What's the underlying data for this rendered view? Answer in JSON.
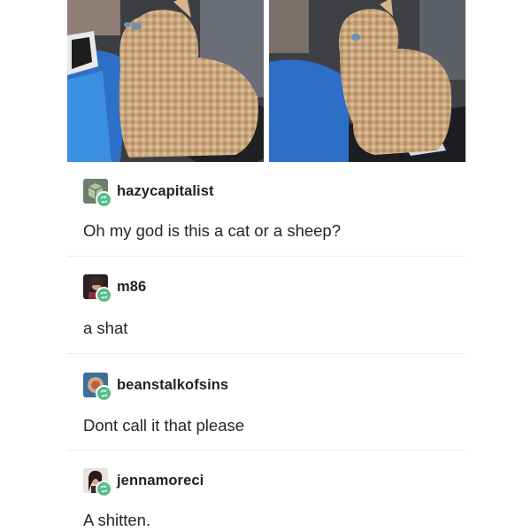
{
  "post": {
    "photos": [
      {
        "alt": "curly kitten photo 1",
        "accent": "#c8a37c"
      },
      {
        "alt": "curly kitten photo 2",
        "accent": "#c4a07a"
      }
    ],
    "entries": [
      {
        "username": "hazycapitalist",
        "text": "Oh my god is this a cat or a sheep?",
        "avatar_icon": "cube-avatar-icon"
      },
      {
        "username": "m86",
        "text": "a shat",
        "avatar_icon": "portrait-avatar-icon"
      },
      {
        "username": "beanstalkofsins",
        "text": "Dont call it that please",
        "avatar_icon": "circle-avatar-icon"
      },
      {
        "username": "jennamoreci",
        "text": "A shitten.",
        "avatar_icon": "portrait-avatar-icon"
      }
    ]
  },
  "colors": {
    "reblog_badge": "#56bc8a",
    "divider": "#ececec",
    "text": "#262626"
  }
}
